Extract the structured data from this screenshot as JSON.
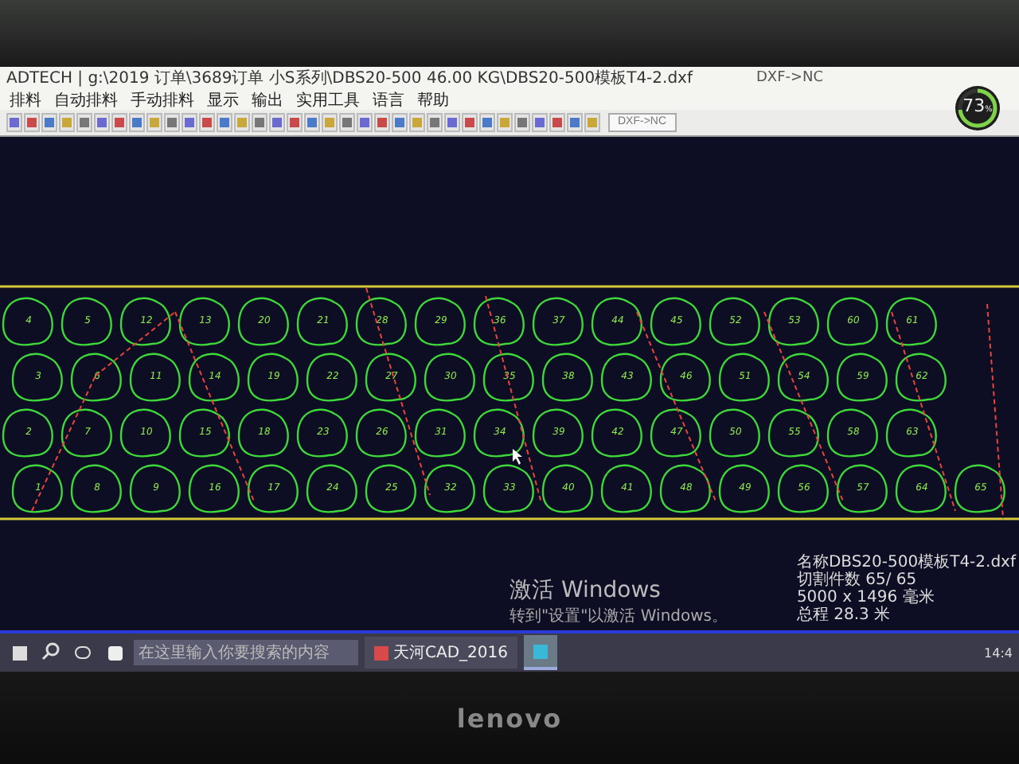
{
  "window": {
    "title": "ADTECH | g:\\2019 订单\\3689订单 小S系列\\DBS20-500 46.00 KG\\DBS20-500模板T4-2.dxf",
    "mode": "DXF->NC"
  },
  "menu": [
    "排料",
    "自动排料",
    "手动排料",
    "显示",
    "输出",
    "实用工具",
    "语言",
    "帮助"
  ],
  "toolbar": {
    "button": "DXF->NC"
  },
  "gauge": {
    "reading": "73",
    "unit": "%",
    "level": 0.73
  },
  "parts": [
    "1",
    "2",
    "3",
    "4",
    "5",
    "6",
    "7",
    "8",
    "9",
    "10",
    "11",
    "12",
    "13",
    "14",
    "15",
    "16",
    "17",
    "18",
    "19",
    "20",
    "21",
    "22",
    "23",
    "24",
    "25",
    "26",
    "27",
    "28",
    "29",
    "30",
    "31",
    "32",
    "33",
    "34",
    "35",
    "36",
    "37",
    "38",
    "39",
    "40",
    "41",
    "42",
    "43",
    "44",
    "45",
    "46",
    "47",
    "48",
    "49",
    "50",
    "51",
    "52",
    "53",
    "54",
    "55",
    "56",
    "57",
    "58",
    "59",
    "60",
    "61",
    "62",
    "63",
    "64",
    "65"
  ],
  "info": [
    "名称DBS20-500模板T4-2.dxf",
    "切割件数 65/ 65",
    "5000 x 1496 毫米",
    "总程 28.3 米"
  ],
  "activation": {
    "title": "激活 Windows",
    "hint": "转到\"设置\"以激活 Windows。"
  },
  "taskbar": {
    "search_placeholder": "在这里输入你要搜索的内容",
    "apps": [
      {
        "label": "天河CAD_2016",
        "selected": false
      },
      {
        "selected": true
      }
    ],
    "clock": "14:4"
  },
  "brand": "lenovo"
}
